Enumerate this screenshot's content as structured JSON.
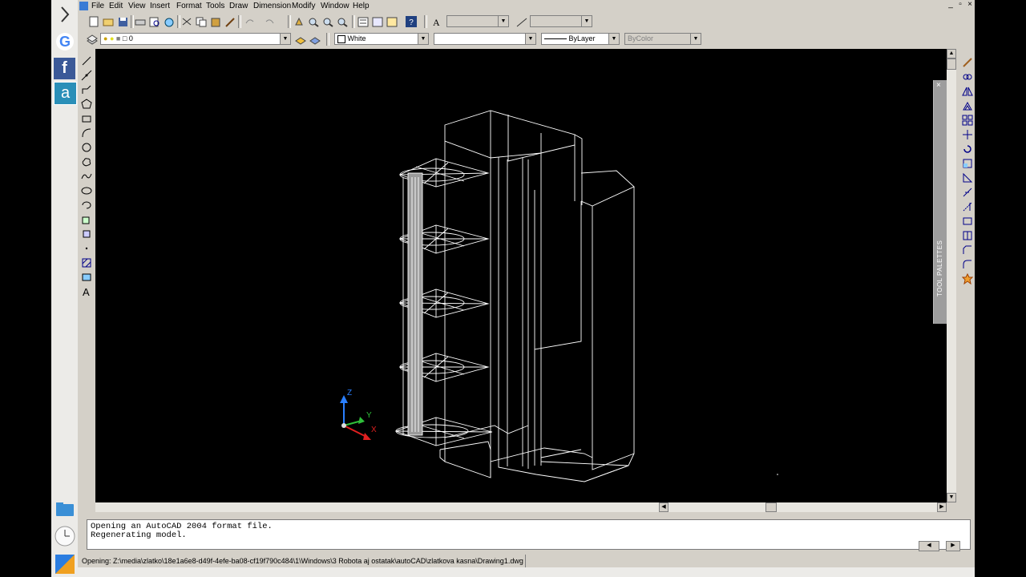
{
  "dock": {
    "items": [
      {
        "icon": "chevron-right-icon"
      },
      {
        "icon": "google-chrome-icon",
        "letter": "G"
      },
      {
        "icon": "facebook-icon",
        "letter": "f"
      },
      {
        "icon": "autocad-icon",
        "letter": "a"
      },
      {
        "icon": "folder-icon"
      },
      {
        "icon": "clock-icon"
      },
      {
        "icon": "launcher-icon"
      }
    ]
  },
  "menubar": {
    "items": [
      "File",
      "Edit",
      "View",
      "Insert",
      "Format",
      "Tools",
      "Draw",
      "Dimension",
      "Modify",
      "Window",
      "Help"
    ],
    "window_controls": [
      "_",
      "▫",
      "×"
    ]
  },
  "properties_bar": {
    "layer_value": "0",
    "color_value": "White",
    "linetype_value": "ByLayer",
    "lineweight_value": "ByColor"
  },
  "palette": {
    "title": "TOOL PALETTES",
    "close": "×"
  },
  "ucs": {
    "z": "Z",
    "y": "Y",
    "x": "X"
  },
  "command_line": {
    "lines": [
      "Opening an AutoCAD 2004 format file.",
      "Regenerating model."
    ]
  },
  "status_bar": {
    "text": "Opening: Z:\\media\\zlatko\\18e1a6e8-d49f-4efe-ba08-cf19f790c484\\1\\Windows\\3 Robota aj ostatak\\autoCAD\\zlatkova kasna\\Drawing1.dwg"
  },
  "colors": {
    "canvas": "#000000",
    "chrome": "#d4d0c8",
    "wireframe": "#ffffff",
    "ucs_z": "#2a7fff",
    "ucs_y": "#2fbf3a",
    "ucs_x": "#e02020"
  }
}
